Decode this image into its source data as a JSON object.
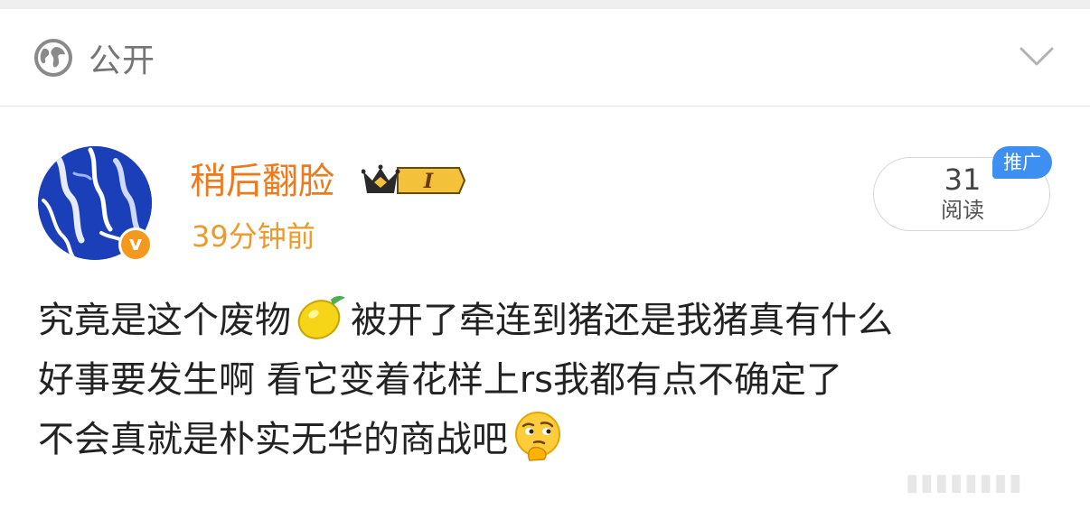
{
  "visibility": {
    "icon": "globe-icon",
    "label": "公开",
    "toggle_icon": "chevron-down-icon"
  },
  "post": {
    "username": "稍后翻脸",
    "member_badge": {
      "icon": "crown-icon",
      "level": "I"
    },
    "verified_icon": "v-badge-icon",
    "timestamp": "39分钟前",
    "reads": {
      "count": "31",
      "label": "阅读"
    },
    "promo_tag": "推广",
    "text_lines": [
      {
        "before": "究竟是这个废物",
        "emoji": "lemon-emoji",
        "after": "被开了牵连到猪还是我猪真有什么"
      },
      {
        "text": "好事要发生啊 看它变着花样上rs我都有点不确定了"
      },
      {
        "before": "不会真就是朴实无华的商战吧",
        "emoji": "thinking-face-emoji"
      }
    ]
  },
  "colors": {
    "username": "#ec7a1e",
    "timestamp": "#ec9a2c",
    "promo": "#3d8ff2",
    "avatar": "#1b3fb8"
  }
}
